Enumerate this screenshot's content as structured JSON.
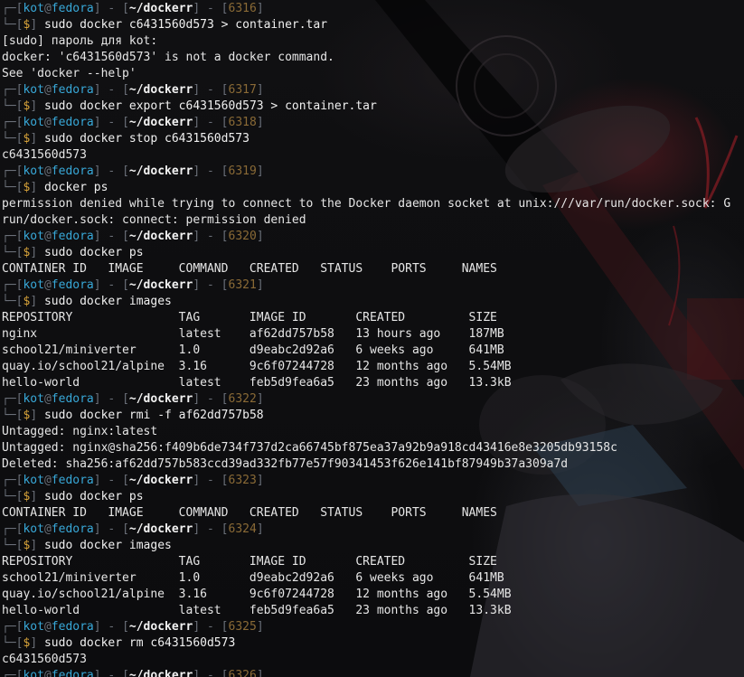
{
  "prompt": {
    "user": "kot",
    "at": "@",
    "host": "fedora",
    "path": "~/dockerr",
    "dollar": "$"
  },
  "lines": [
    {
      "type": "prompt2",
      "cmd": "sudo docker c6431560d573 > container.tar"
    },
    {
      "type": "out",
      "text": "[sudo] пароль для kot:"
    },
    {
      "type": "out",
      "text": "docker: 'c6431560d573' is not a docker command."
    },
    {
      "type": "out",
      "text": "See 'docker --help'"
    },
    {
      "type": "prompt1",
      "num": "6317"
    },
    {
      "type": "prompt2",
      "cmd": "sudo docker export c6431560d573 > container.tar"
    },
    {
      "type": "prompt1",
      "num": "6318"
    },
    {
      "type": "prompt2",
      "cmd": "sudo docker stop c6431560d573"
    },
    {
      "type": "out",
      "text": "c6431560d573"
    },
    {
      "type": "prompt1",
      "num": "6319"
    },
    {
      "type": "prompt2",
      "cmd": "docker ps"
    },
    {
      "type": "out",
      "text": "permission denied while trying to connect to the Docker daemon socket at unix:///var/run/docker.sock: G"
    },
    {
      "type": "out",
      "text": "run/docker.sock: connect: permission denied"
    },
    {
      "type": "prompt1",
      "num": "6320"
    },
    {
      "type": "prompt2",
      "cmd": "sudo docker ps"
    },
    {
      "type": "out",
      "text": "CONTAINER ID   IMAGE     COMMAND   CREATED   STATUS    PORTS     NAMES"
    },
    {
      "type": "prompt1",
      "num": "6321"
    },
    {
      "type": "prompt2",
      "cmd": "sudo docker images"
    },
    {
      "type": "out",
      "text": "REPOSITORY               TAG       IMAGE ID       CREATED         SIZE"
    },
    {
      "type": "out",
      "text": "nginx                    latest    af62dd757b58   13 hours ago    187MB"
    },
    {
      "type": "out",
      "text": "school21/miniverter      1.0       d9eabc2d92a6   6 weeks ago     641MB"
    },
    {
      "type": "out",
      "text": "quay.io/school21/alpine  3.16      9c6f07244728   12 months ago   5.54MB"
    },
    {
      "type": "out",
      "text": "hello-world              latest    feb5d9fea6a5   23 months ago   13.3kB"
    },
    {
      "type": "prompt1",
      "num": "6322"
    },
    {
      "type": "prompt2",
      "cmd": "sudo docker rmi -f af62dd757b58"
    },
    {
      "type": "out",
      "text": "Untagged: nginx:latest"
    },
    {
      "type": "out",
      "text": "Untagged: nginx@sha256:f409b6de734f737d2ca66745bf875ea37a92b9a918cd43416e8e3205db93158c"
    },
    {
      "type": "out",
      "text": "Deleted: sha256:af62dd757b583ccd39ad332fb77e57f90341453f626e141bf87949b37a309a7d"
    },
    {
      "type": "prompt1",
      "num": "6323"
    },
    {
      "type": "prompt2",
      "cmd": "sudo docker ps"
    },
    {
      "type": "out",
      "text": "CONTAINER ID   IMAGE     COMMAND   CREATED   STATUS    PORTS     NAMES"
    },
    {
      "type": "prompt1",
      "num": "6324"
    },
    {
      "type": "prompt2",
      "cmd": "sudo docker images"
    },
    {
      "type": "out",
      "text": "REPOSITORY               TAG       IMAGE ID       CREATED         SIZE"
    },
    {
      "type": "out",
      "text": "school21/miniverter      1.0       d9eabc2d92a6   6 weeks ago     641MB"
    },
    {
      "type": "out",
      "text": "quay.io/school21/alpine  3.16      9c6f07244728   12 months ago   5.54MB"
    },
    {
      "type": "out",
      "text": "hello-world              latest    feb5d9fea6a5   23 months ago   13.3kB"
    },
    {
      "type": "prompt1",
      "num": "6325"
    },
    {
      "type": "prompt2",
      "cmd": "sudo docker rm c6431560d573"
    },
    {
      "type": "out",
      "text": "c6431560d573"
    },
    {
      "type": "prompt1",
      "num": "6326"
    }
  ],
  "top_line": {
    "num": "6316"
  },
  "colors": {
    "bracket": "#6a6f78",
    "user": "#38a8d8",
    "path": "#f2f2f2",
    "number": "#d9a43a",
    "dollar": "#d9a43a",
    "text": "#e6e6e6"
  }
}
